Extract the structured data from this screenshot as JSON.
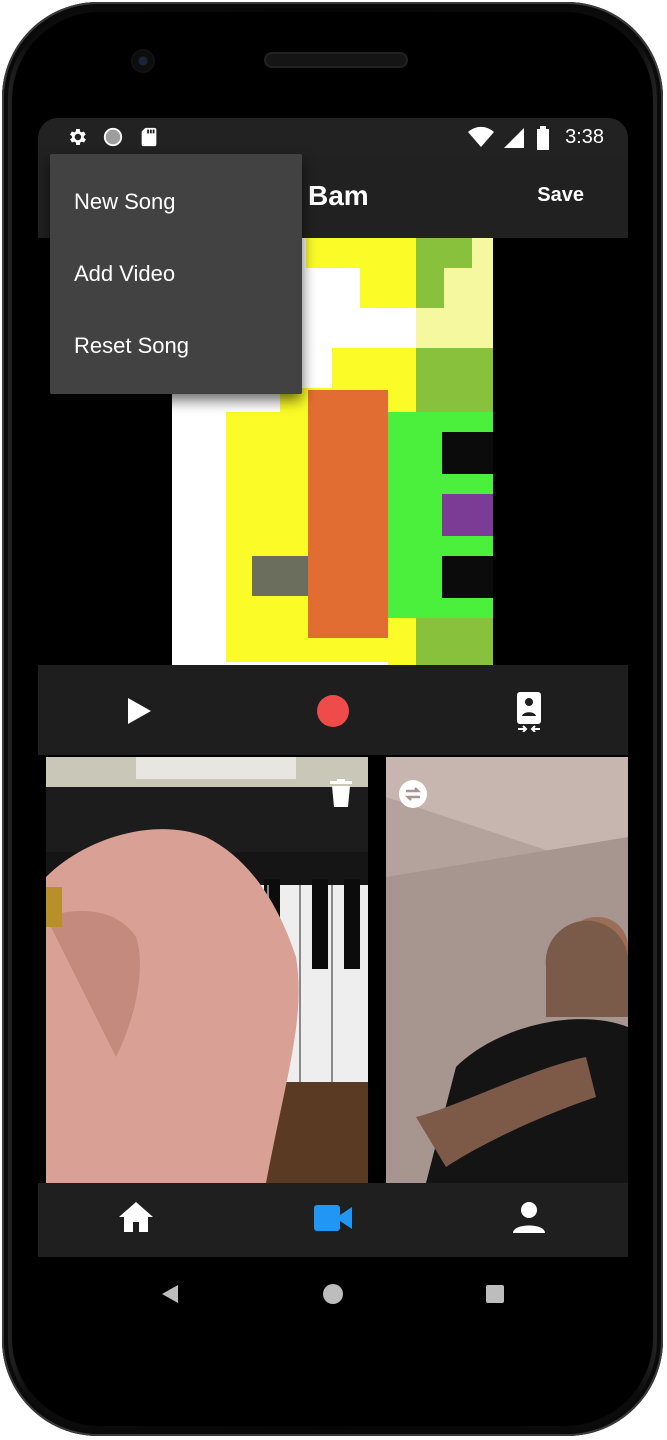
{
  "status_bar": {
    "time": "3:38"
  },
  "app_bar": {
    "title": "Bam",
    "save_label": "Save"
  },
  "overflow_menu": {
    "items": [
      "New Song",
      "Add Video",
      "Reset Song"
    ]
  },
  "controls": {
    "icons": [
      "play-icon",
      "record-icon",
      "switch-camera-icon"
    ],
    "record_color": "#f04b4b"
  },
  "video_tiles": [
    {
      "content": "piano-video",
      "icon": "trash-icon"
    },
    {
      "content": "trumpet-video",
      "icon": "swap-icon"
    }
  ],
  "bottom_nav": {
    "items": [
      "home-icon",
      "video-camera-icon",
      "person-icon"
    ],
    "active": "video-camera-icon",
    "active_color": "#2196f3"
  },
  "system_nav": [
    "back-icon",
    "home-circle-icon",
    "overview-icon"
  ]
}
